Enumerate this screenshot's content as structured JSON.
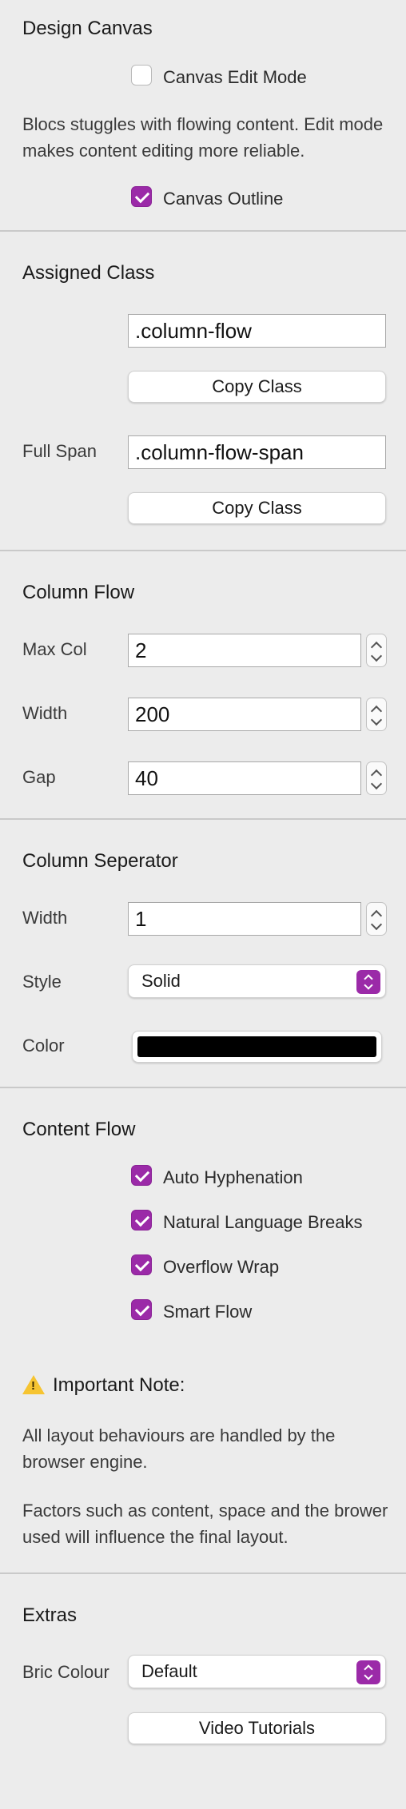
{
  "design_canvas": {
    "title": "Design Canvas",
    "edit_mode_label": "Canvas Edit Mode",
    "edit_mode_checked": false,
    "note": "Blocs stuggles with flowing content. Edit mode makes content editing more reliable.",
    "outline_label": "Canvas Outline",
    "outline_checked": true
  },
  "assigned_class": {
    "title": "Assigned Class",
    "class_value": ".column-flow",
    "copy_label": "Copy Class",
    "full_span_label": "Full Span",
    "full_span_value": ".column-flow-span",
    "copy_label_2": "Copy Class"
  },
  "column_flow": {
    "title": "Column Flow",
    "max_col_label": "Max Col",
    "max_col_value": "2",
    "width_label": "Width",
    "width_value": "200",
    "gap_label": "Gap",
    "gap_value": "40"
  },
  "column_separator": {
    "title": "Column Seperator",
    "width_label": "Width",
    "width_value": "1",
    "style_label": "Style",
    "style_value": "Solid",
    "color_label": "Color",
    "color_value": "#000000"
  },
  "content_flow": {
    "title": "Content Flow",
    "options": [
      {
        "label": "Auto Hyphenation",
        "checked": true
      },
      {
        "label": "Natural Language Breaks",
        "checked": true
      },
      {
        "label": "Overflow Wrap",
        "checked": true
      },
      {
        "label": "Smart Flow",
        "checked": true
      }
    ]
  },
  "note": {
    "title": "Important Note:",
    "icon": "warning-icon",
    "paragraph_1": "All layout behaviours are handled by the browser engine.",
    "paragraph_2": "Factors such as content, space and the brower used will influence the final layout."
  },
  "extras": {
    "title": "Extras",
    "bric_colour_label": "Bric Colour",
    "bric_colour_value": "Default",
    "video_button_label": "Video Tutorials"
  },
  "colors": {
    "accent": "#9b2aa8",
    "background": "#ececec",
    "warning": "#f6c431"
  }
}
